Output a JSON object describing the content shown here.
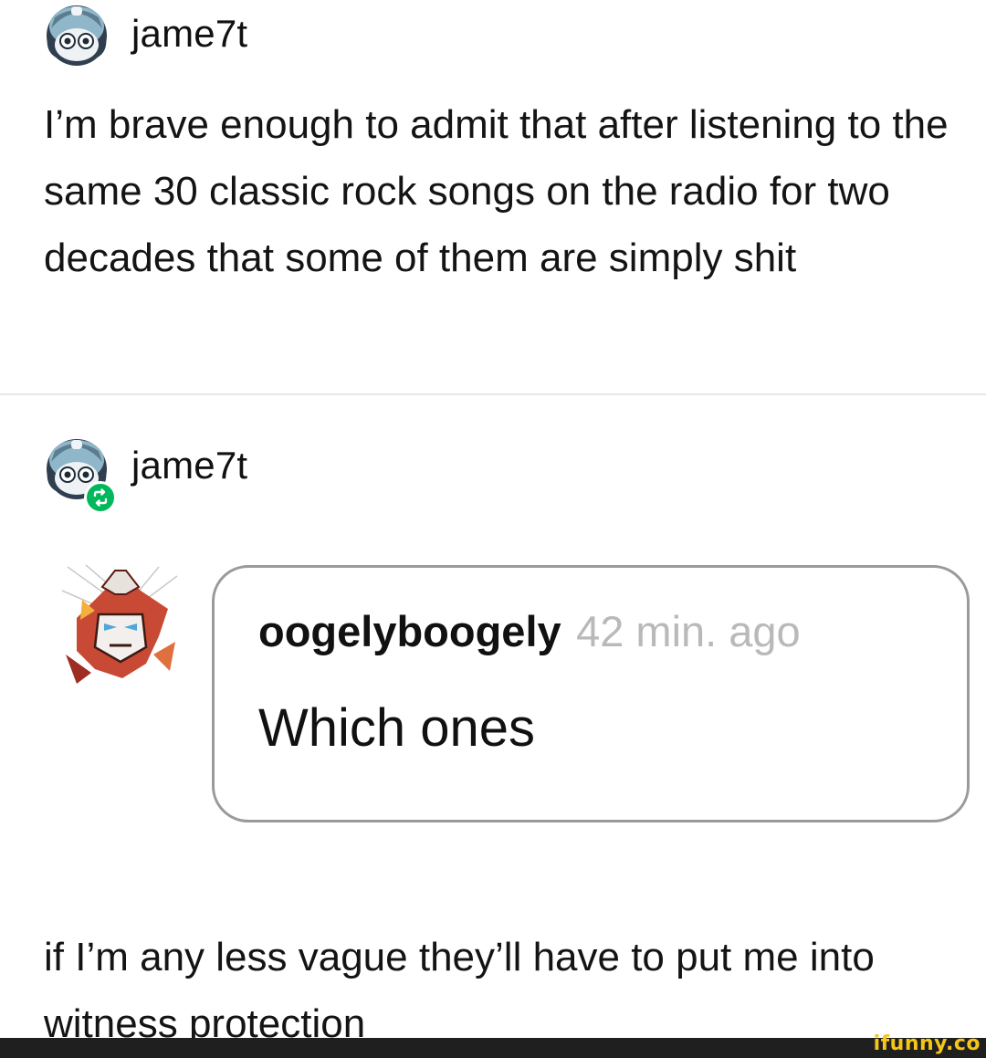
{
  "post": {
    "username": "jame7t",
    "text": "I’m brave enough to admit that after listening to the same 30 classic rock songs on the radio for two decades that some of them are simply shit"
  },
  "reblog": {
    "username": "jame7t",
    "badge_icon": "reblog-icon",
    "badge_color": "#00b85c",
    "comment": {
      "username": "oogelyboogely",
      "time": "42 min. ago",
      "text": "Which ones"
    },
    "text": "if I’m any less vague they’ll have to put me into witness protection"
  },
  "watermark": {
    "text": "ifunny.co",
    "color": "#f5c518"
  }
}
